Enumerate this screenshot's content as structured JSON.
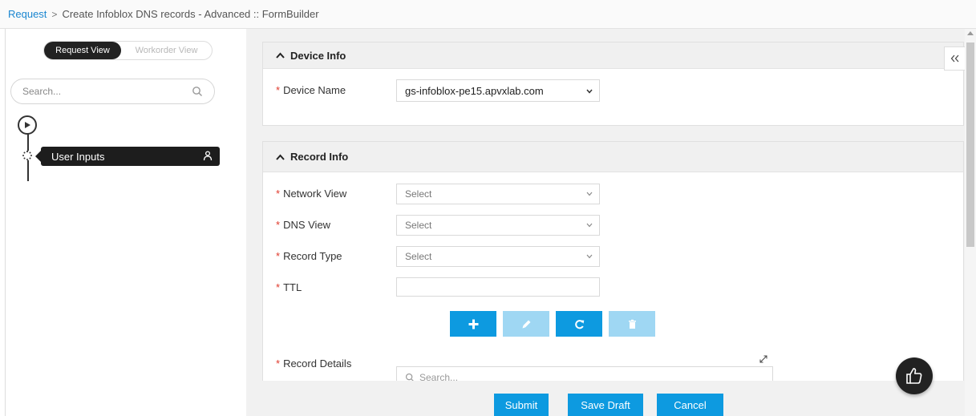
{
  "breadcrumb": {
    "root": "Request",
    "separator": ">",
    "current": "Create Infoblox DNS records - Advanced :: FormBuilder"
  },
  "left_panel": {
    "view_toggle": {
      "active": "Request View",
      "inactive": "Workorder View"
    },
    "search": {
      "placeholder": "Search..."
    },
    "steps": [
      {
        "label": "User Inputs",
        "icon": "user-icon"
      }
    ]
  },
  "device_info": {
    "title": "Device Info",
    "device_name": {
      "label": "Device Name",
      "value": "gs-infoblox-pe15.apvxlab.com"
    }
  },
  "record_info": {
    "title": "Record Info",
    "fields": [
      {
        "label": "Network View",
        "value": "Select"
      },
      {
        "label": "DNS View",
        "value": "Select"
      },
      {
        "label": "Record Type",
        "value": "Select"
      },
      {
        "label": "TTL",
        "value": ""
      }
    ],
    "record_details_label": "Record Details",
    "grid_search_placeholder": "Search..."
  },
  "footer": {
    "submit": "Submit",
    "save_draft": "Save Draft",
    "cancel": "Cancel"
  },
  "colors": {
    "accent": "#0d9ae0",
    "disabled": "#9fd7f3",
    "link": "#1a86d0",
    "required": "#e0392b"
  }
}
